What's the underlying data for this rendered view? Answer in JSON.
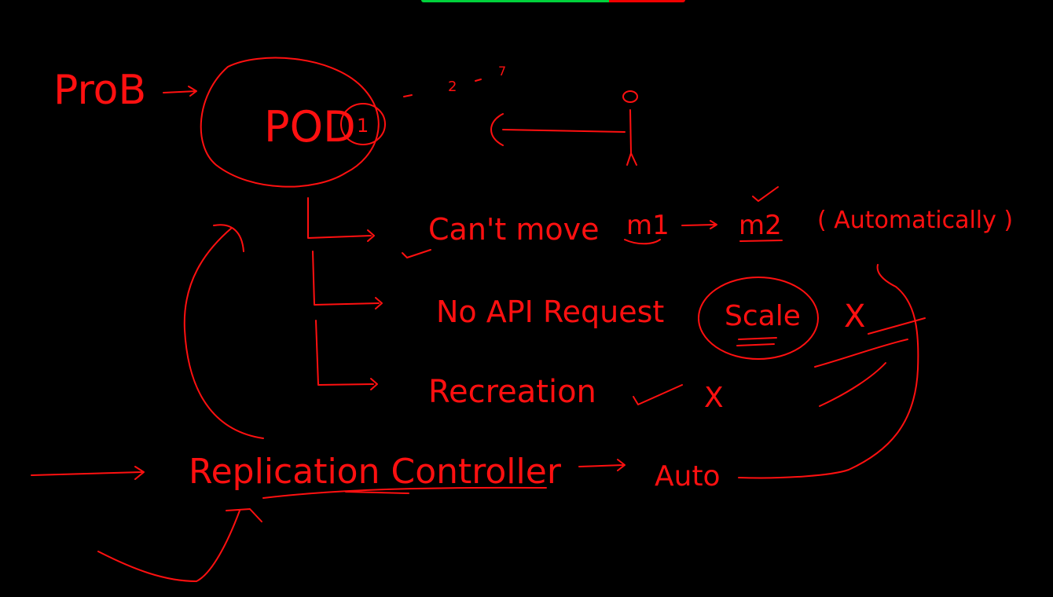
{
  "progress_bar": {
    "fraction_green": 0.71,
    "colors": {
      "green": "#00d13b",
      "red": "#f00000"
    }
  },
  "ink_color": "#ff1010",
  "background": "#000000",
  "labels": {
    "prob": "ProB",
    "pod": "POD",
    "pod_number": "1",
    "dash_numbers": [
      "2",
      "7"
    ],
    "cant_move": "Can't move",
    "m1": "m1",
    "m2": "m2",
    "automatically": "( Automatically )",
    "no_api_request": "No API Request",
    "scale": "Scale",
    "scale_mark": "X",
    "recreation": "Recreation",
    "recreation_mark": "X",
    "replication_controller": "Replication Controller",
    "auto": "Auto"
  }
}
